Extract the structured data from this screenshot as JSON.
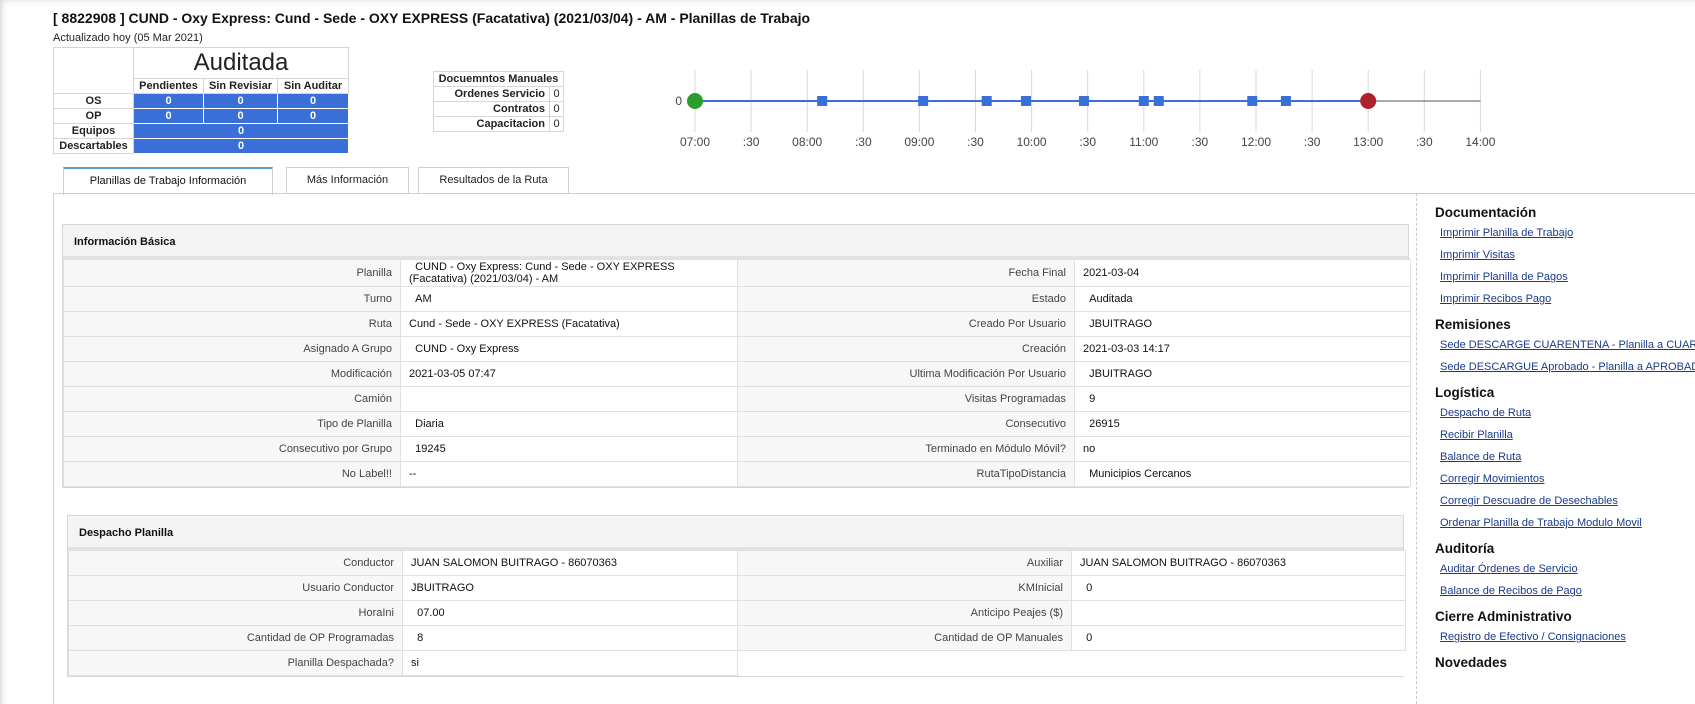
{
  "header": {
    "title": "[ 8822908 ] CUND - Oxy Express: Cund - Sede - OXY EXPRESS (Facatativa) (2021/03/04) - AM - Planillas de Trabajo",
    "updated": "Actualizado hoy (05 Mar 2021)"
  },
  "summary": {
    "status": "Auditada",
    "columns": [
      "Pendientes",
      "Sin Revisiar",
      "Sin Auditar"
    ],
    "rows": [
      {
        "label": "OS",
        "values": [
          "0",
          "0",
          "0"
        ]
      },
      {
        "label": "OP",
        "values": [
          "0",
          "0",
          "0"
        ]
      }
    ],
    "equipos": {
      "label": "Equipos",
      "value": "0"
    },
    "descartables": {
      "label": "Descartables",
      "value": "0"
    },
    "colors": {
      "cell_blue": "#3a6fd8"
    }
  },
  "manual_docs": {
    "title": "Docuemntos Manuales",
    "rows": [
      {
        "label": "Ordenes Servicio",
        "value": "0"
      },
      {
        "label": "Contratos",
        "value": "0"
      },
      {
        "label": "Capacitacion",
        "value": "0"
      }
    ]
  },
  "timeline": {
    "y_label": "0",
    "ticks": [
      "07:00",
      ":30",
      "08:00",
      ":30",
      "09:00",
      ":30",
      "10:00",
      ":30",
      "11:00",
      ":30",
      "12:00",
      ":30",
      "13:00",
      ":30",
      "14:00"
    ],
    "start_time": "07:00",
    "end_marker": "13:00",
    "visits": [
      "08:08",
      "09:02",
      "09:36",
      "09:57",
      "10:28",
      "11:00",
      "11:08",
      "11:58",
      "12:16"
    ],
    "colors": {
      "line": "#3a6fd8",
      "start": "#2a9d2a",
      "end": "#b0202a",
      "square": "#3a6fd8"
    }
  },
  "tabs": [
    {
      "label": "Planillas de Trabajo Información",
      "active": true
    },
    {
      "label": "Más Información",
      "active": false
    },
    {
      "label": "Resultados de la Ruta",
      "active": false
    }
  ],
  "basic_info": {
    "title": "Información Básica",
    "rows": [
      {
        "l1": "Planilla",
        "v1": "  CUND - Oxy Express: Cund - Sede - OXY EXPRESS (Facatativa) (2021/03/04) - AM",
        "l2": "Fecha Final",
        "v2": "2021-03-04"
      },
      {
        "l1": "Turno",
        "v1": "  AM",
        "l2": "Estado",
        "v2": "  Auditada"
      },
      {
        "l1": "Ruta",
        "v1": "Cund - Sede - OXY EXPRESS (Facatativa)",
        "l2": "Creado Por Usuario",
        "v2": "  JBUITRAGO"
      },
      {
        "l1": "Asignado A Grupo",
        "v1": "  CUND - Oxy Express",
        "l2": "Creación",
        "v2": "2021-03-03 14:17"
      },
      {
        "l1": "Modificación",
        "v1": "2021-03-05 07:47",
        "l2": "Ultima Modificación Por Usuario",
        "v2": "  JBUITRAGO"
      },
      {
        "l1": "Camión",
        "v1": "",
        "l2": "Visitas Programadas",
        "v2": "  9"
      },
      {
        "l1": "Tipo de Planilla",
        "v1": "  Diaria",
        "l2": "Consecutivo",
        "v2": "  26915"
      },
      {
        "l1": "Consecutivo por Grupo",
        "v1": "  19245",
        "l2": "Terminado en Módulo Móvil?",
        "v2": "no"
      },
      {
        "l1": "No Label!!",
        "v1": "--",
        "l2": "RutaTipoDistancia",
        "v2": "  Municipios Cercanos"
      }
    ]
  },
  "dispatch": {
    "title": "Despacho Planilla",
    "rows": [
      {
        "l1": "Conductor",
        "v1": "JUAN SALOMON BUITRAGO - 86070363",
        "l2": "Auxiliar",
        "v2": "JUAN SALOMON BUITRAGO - 86070363"
      },
      {
        "l1": "Usuario Conductor",
        "v1": "JBUITRAGO",
        "l2": "KMInicial",
        "v2": "  0"
      },
      {
        "l1": "HoraIni",
        "v1": "  07.00",
        "l2": "Anticipo Peajes ($)",
        "v2": ""
      },
      {
        "l1": "Cantidad de OP Programadas",
        "v1": "  8",
        "l2": "Cantidad de OP Manuales",
        "v2": "  0"
      },
      {
        "l1": "Planilla Despachada?",
        "v1": "si",
        "l2": "",
        "v2": ""
      }
    ]
  },
  "sidebar": {
    "sections": [
      {
        "title": "Documentación",
        "links": [
          "Imprimir Planilla de Trabajo",
          "Imprimir Visitas",
          "Imprimir Planilla de Pagos",
          "Imprimir Recibos Pago"
        ]
      },
      {
        "title": "Remisiones",
        "links": [
          "Sede DESCARGE CUARENTENA - Planilla a CUARENTENA",
          "Sede DESCARGUE Aprobado - Planilla a APROBADO"
        ]
      },
      {
        "title": "Logística",
        "links": [
          "Despacho de Ruta",
          "Recibir Planilla",
          "Balance de Ruta",
          "Corregir Movimientos",
          "Corregir Descuadre de Desechables",
          "Ordenar Planilla de Trabajo Modulo Movil"
        ]
      },
      {
        "title": "Auditoría",
        "links": [
          "Auditar Órdenes de Servicio",
          "Balance de Recibos de Pago"
        ]
      },
      {
        "title": "Cierre Administrativo",
        "links": [
          "Registro de Efectivo / Consignaciones"
        ]
      },
      {
        "title": "Novedades",
        "links": []
      }
    ]
  }
}
